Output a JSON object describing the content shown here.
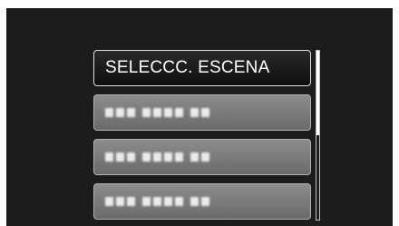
{
  "menu": {
    "items": [
      {
        "label": "SELECCC. ESCENA",
        "state": "selected"
      },
      {
        "label": "",
        "state": "disabled"
      },
      {
        "label": "",
        "state": "disabled"
      },
      {
        "label": "",
        "state": "disabled"
      }
    ]
  },
  "scrollbar": {
    "position_fraction": 0.0,
    "visible_fraction": 0.5
  },
  "colors": {
    "screen_background": "#1c1c1c",
    "selected_item": "#141414",
    "disabled_item": "#7a7a7a",
    "text": "#ffffff"
  }
}
